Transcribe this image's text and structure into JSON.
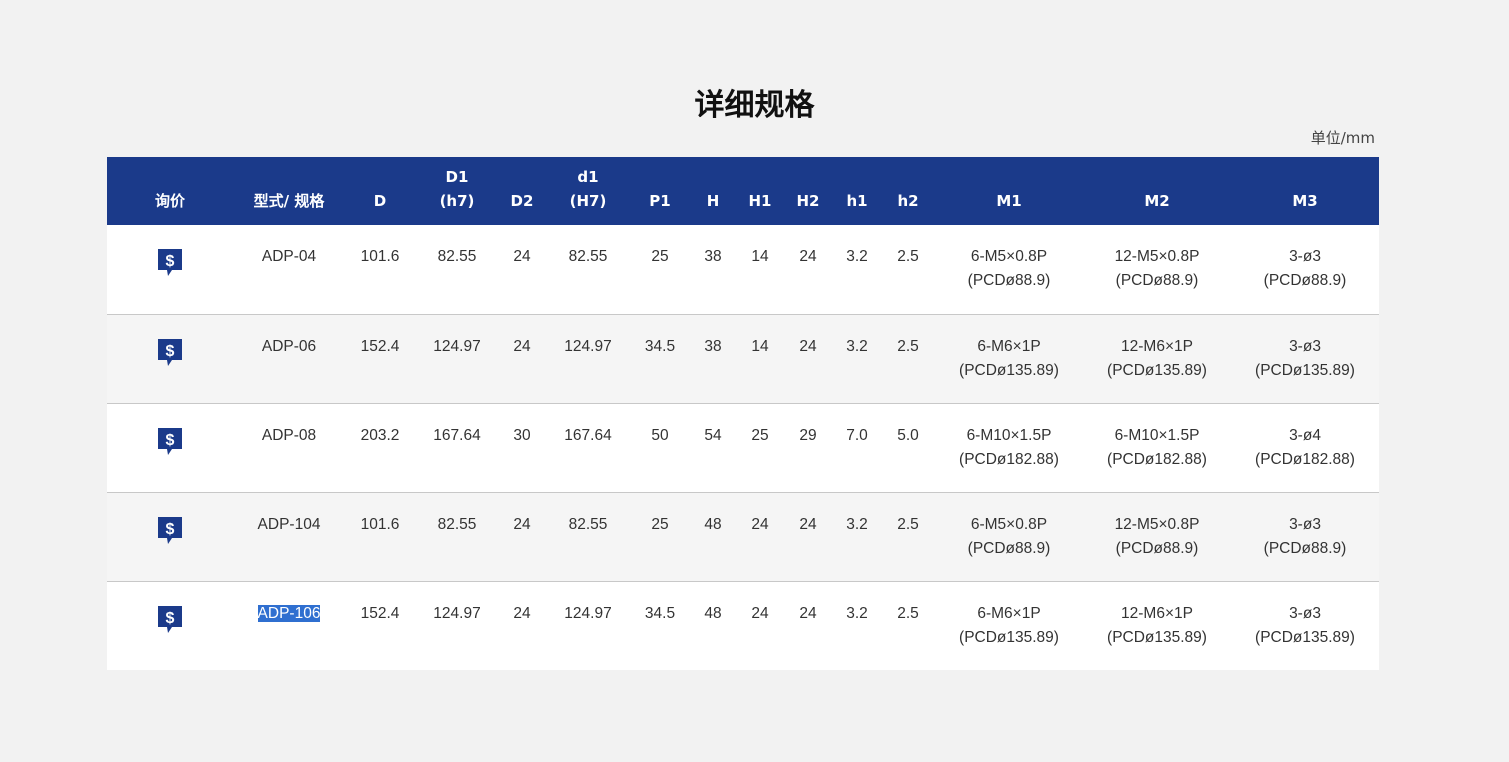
{
  "page": {
    "title": "详细规格",
    "unit": "单位/mm"
  },
  "table": {
    "headers": [
      {
        "line1": "",
        "line2": "询价"
      },
      {
        "line1": "",
        "line2": "型式/ 规格"
      },
      {
        "line1": "",
        "line2": "D"
      },
      {
        "line1": "D1",
        "line2": "(h7)"
      },
      {
        "line1": "",
        "line2": "D2"
      },
      {
        "line1": "d1",
        "line2": "(H7)"
      },
      {
        "line1": "",
        "line2": "P1"
      },
      {
        "line1": "",
        "line2": "H"
      },
      {
        "line1": "",
        "line2": "H1"
      },
      {
        "line1": "",
        "line2": "H2"
      },
      {
        "line1": "",
        "line2": "h1"
      },
      {
        "line1": "",
        "line2": "h2"
      },
      {
        "line1": "",
        "line2": "M1"
      },
      {
        "line1": "",
        "line2": "M2"
      },
      {
        "line1": "",
        "line2": "M3"
      }
    ],
    "quote_icon": "dollar-speech-bubble-icon",
    "icon_color": "#1b3a8a",
    "rows": [
      {
        "model": "ADP-04",
        "D": "101.6",
        "D1": "82.55",
        "D2": "24",
        "d1": "82.55",
        "P1": "25",
        "H": "38",
        "H1": "14",
        "H2": "24",
        "h1": "3.2",
        "h2": "2.5",
        "M1": [
          "6-M5×0.8P",
          "(PCDø88.9)"
        ],
        "M2": [
          "12-M5×0.8P",
          "(PCDø88.9)"
        ],
        "M3": [
          "3-ø3",
          "(PCDø88.9)"
        ]
      },
      {
        "model": "ADP-06",
        "D": "152.4",
        "D1": "124.97",
        "D2": "24",
        "d1": "124.97",
        "P1": "34.5",
        "H": "38",
        "H1": "14",
        "H2": "24",
        "h1": "3.2",
        "h2": "2.5",
        "M1": [
          "6-M6×1P",
          "(PCDø135.89)"
        ],
        "M2": [
          "12-M6×1P",
          "(PCDø135.89)"
        ],
        "M3": [
          "3-ø3",
          "(PCDø135.89)"
        ]
      },
      {
        "model": "ADP-08",
        "D": "203.2",
        "D1": "167.64",
        "D2": "30",
        "d1": "167.64",
        "P1": "50",
        "H": "54",
        "H1": "25",
        "H2": "29",
        "h1": "7.0",
        "h2": "5.0",
        "M1": [
          "6-M10×1.5P",
          "(PCDø182.88)"
        ],
        "M2": [
          "6-M10×1.5P",
          "(PCDø182.88)"
        ],
        "M3": [
          "3-ø4",
          "(PCDø182.88)"
        ]
      },
      {
        "model": "ADP-104",
        "D": "101.6",
        "D1": "82.55",
        "D2": "24",
        "d1": "82.55",
        "P1": "25",
        "H": "48",
        "H1": "24",
        "H2": "24",
        "h1": "3.2",
        "h2": "2.5",
        "M1": [
          "6-M5×0.8P",
          "(PCDø88.9)"
        ],
        "M2": [
          "12-M5×0.8P",
          "(PCDø88.9)"
        ],
        "M3": [
          "3-ø3",
          "(PCDø88.9)"
        ]
      },
      {
        "model": "ADP-106",
        "D": "152.4",
        "D1": "124.97",
        "D2": "24",
        "d1": "124.97",
        "P1": "34.5",
        "H": "48",
        "H1": "24",
        "H2": "24",
        "h1": "3.2",
        "h2": "2.5",
        "M1": [
          "6-M6×1P",
          "(PCDø135.89)"
        ],
        "M2": [
          "12-M6×1P",
          "(PCDø135.89)"
        ],
        "M3": [
          "3-ø3",
          "(PCDø135.89)"
        ],
        "model_selected": true
      }
    ]
  }
}
